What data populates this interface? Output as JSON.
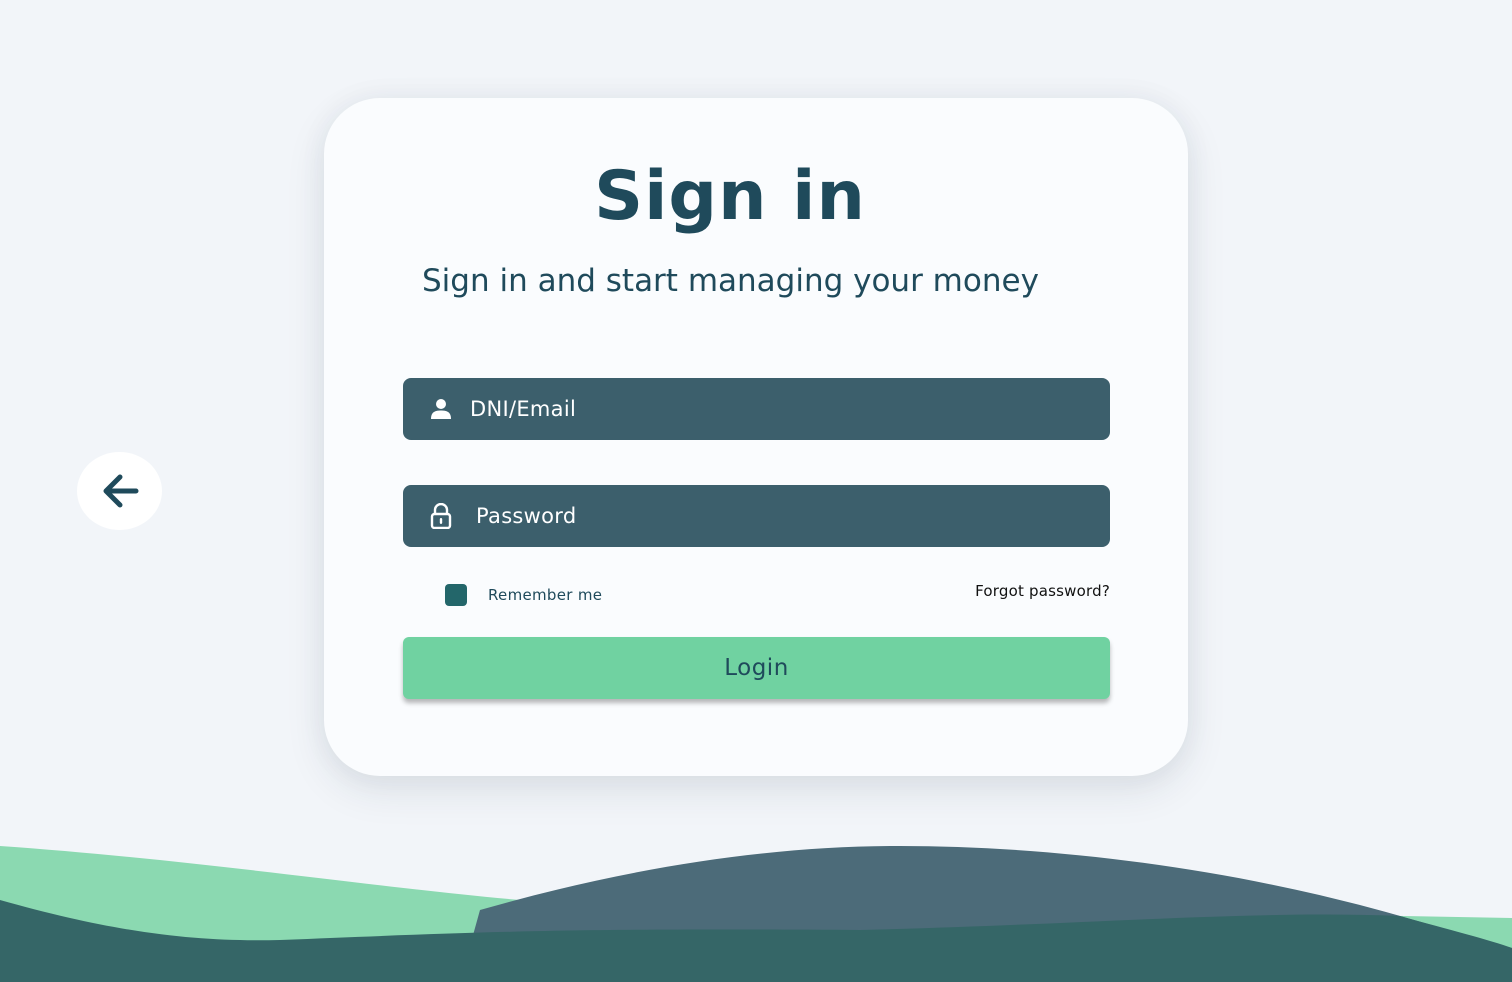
{
  "back": {
    "icon": "arrow-left-icon"
  },
  "signin": {
    "title": "Sign in",
    "subtitle": "Sign in and start managing your money",
    "email_placeholder": "DNI/Email",
    "email_icon": "user-icon",
    "password_placeholder": "Password",
    "password_icon": "lock-icon",
    "remember_label": "Remember me",
    "remember_checked": true,
    "forgot_label": "Forgot password?",
    "login_label": "Login"
  },
  "colors": {
    "background": "#f2f5f9",
    "card": "#fafcfe",
    "primary_dark": "#1f4a5b",
    "field_bg": "#3c5f6c",
    "accent_green": "#70d2a1",
    "checkbox": "#23666a",
    "wave_green": "#8bd9b1",
    "wave_slate": "#4c6b79",
    "wave_teal": "#356667"
  }
}
